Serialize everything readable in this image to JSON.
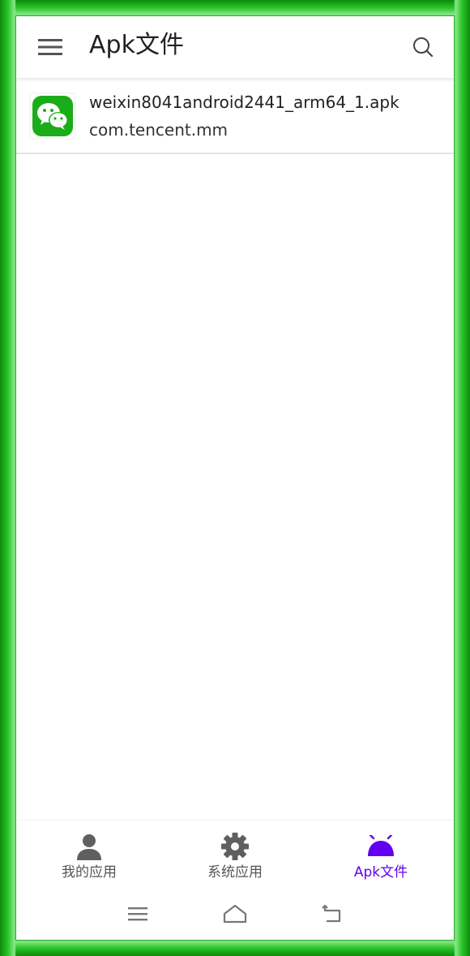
{
  "appbar": {
    "title": "Apk文件",
    "menu_icon": "hamburger-menu-icon",
    "search_icon": "search-icon"
  },
  "apk_list": [
    {
      "file_name": "weixin8041android2441_arm64_1.apk",
      "package": "com.tencent.mm",
      "icon": "wechat-app-icon",
      "icon_color": "#1aad19"
    }
  ],
  "bottom_nav": {
    "active_color": "#6200ee",
    "inactive_color": "#555555",
    "items": [
      {
        "label": "我的应用",
        "icon": "person-icon",
        "active": false
      },
      {
        "label": "系统应用",
        "icon": "gear-icon",
        "active": false
      },
      {
        "label": "Apk文件",
        "icon": "android-icon",
        "active": true
      }
    ]
  },
  "system_nav": {
    "menu": "recent-apps-icon",
    "home": "home-icon",
    "back": "back-icon"
  },
  "frame_color": "#19a319"
}
